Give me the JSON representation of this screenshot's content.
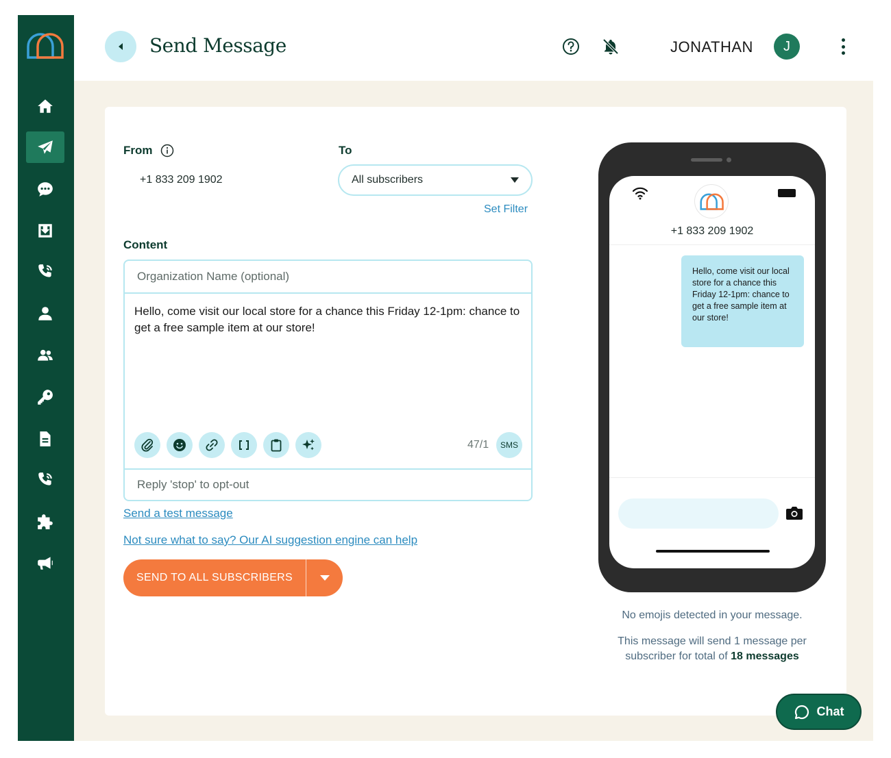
{
  "header": {
    "title": "Send Message",
    "username": "JONATHAN",
    "avatar_initial": "J"
  },
  "sidebar": {
    "items": [
      {
        "name": "home",
        "icon": "home-icon"
      },
      {
        "name": "send",
        "icon": "paper-plane-icon",
        "active": true
      },
      {
        "name": "messages",
        "icon": "chat-bubble-icon"
      },
      {
        "name": "inbox",
        "icon": "inbox-download-icon"
      },
      {
        "name": "calls",
        "icon": "phone-call-icon"
      },
      {
        "name": "contact",
        "icon": "person-icon"
      },
      {
        "name": "groups",
        "icon": "people-icon"
      },
      {
        "name": "keywords",
        "icon": "key-icon"
      },
      {
        "name": "documents",
        "icon": "document-icon"
      },
      {
        "name": "voice",
        "icon": "phone-call-icon"
      },
      {
        "name": "integrations",
        "icon": "puzzle-icon"
      },
      {
        "name": "campaigns",
        "icon": "megaphone-icon"
      }
    ]
  },
  "form": {
    "from_label": "From",
    "from_value": "+1 833 209 1902",
    "to_label": "To",
    "to_value": "All subscribers",
    "set_filter": "Set Filter",
    "content_label": "Content",
    "org_placeholder": "Organization Name (optional)",
    "message": "Hello, come visit our local store for a chance this Friday 12-1pm: chance to get a free sample item at our store!",
    "counter": "47/1",
    "sms_badge": "SMS",
    "optout": "Reply 'stop' to opt-out",
    "test_link": "Send a test message",
    "ai_link": "Not sure what to say? Our AI suggestion engine can help",
    "send_button": "SEND TO ALL SUBSCRIBERS"
  },
  "preview": {
    "phone_number": "+1 833 209 1902",
    "bubble_text": "Hello, come visit our local store for a chance this Friday 12-1pm: chance to get a free sample item at our store!",
    "emoji_note": "No emojis detected in your message.",
    "count_note_prefix": "This message will send 1 message per subscriber for total of",
    "count_note_total": "18 messages"
  },
  "chat": {
    "label": "Chat"
  },
  "colors": {
    "sidebar": "#0b4a37",
    "accent_orange": "#f47a3e",
    "light_blue": "#c5ecf3",
    "link_blue": "#2b8bbf"
  }
}
